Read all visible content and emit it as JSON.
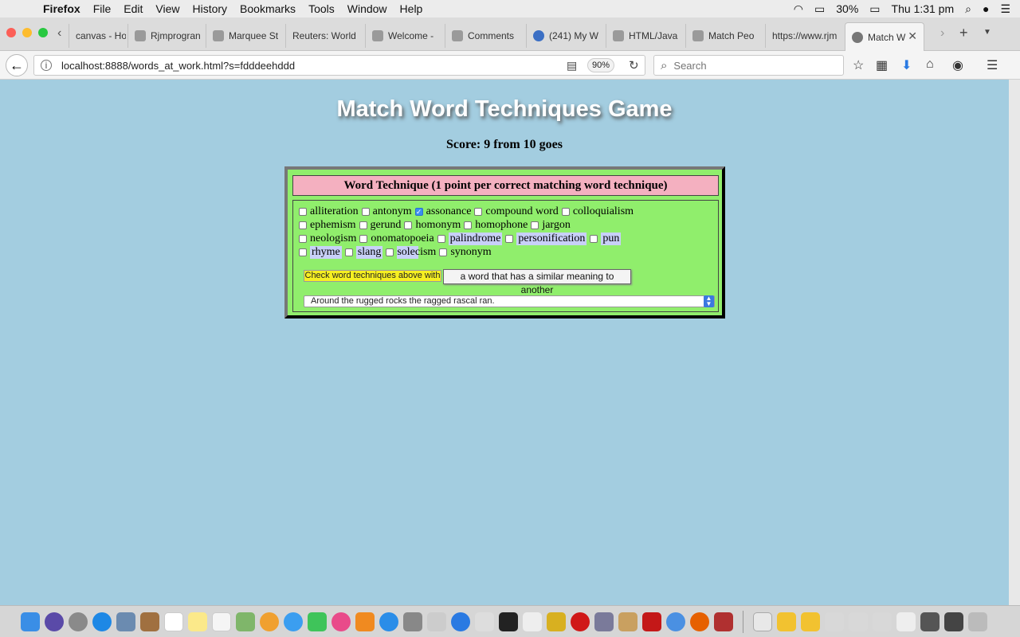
{
  "menubar": {
    "app_name": "Firefox",
    "items": [
      "File",
      "Edit",
      "View",
      "History",
      "Bookmarks",
      "Tools",
      "Window",
      "Help"
    ],
    "battery": "30%",
    "clock": "Thu 1:31 pm"
  },
  "tabs": [
    {
      "label": "canvas - Ho"
    },
    {
      "label": "Rjmprogran"
    },
    {
      "label": "Marquee St"
    },
    {
      "label": "Reuters: World"
    },
    {
      "label": "Welcome -"
    },
    {
      "label": "Comments"
    },
    {
      "label": "(241) My W"
    },
    {
      "label": "HTML/Java"
    },
    {
      "label": "Match Peo"
    },
    {
      "label": "https://www.rjm"
    },
    {
      "label": "Match W",
      "active": true
    }
  ],
  "navbar": {
    "url": "localhost:8888/words_at_work.html?s=fdddeehddd",
    "zoom": "90%",
    "search_placeholder": "Search"
  },
  "page": {
    "title": "Match Word Techniques Game",
    "score": "Score: 9 from 10 goes",
    "heading": "Word Technique (1 point per correct matching word technique)",
    "techniques": [
      {
        "label": "alliteration",
        "checked": false,
        "highlight": false
      },
      {
        "label": "antonym",
        "checked": false,
        "highlight": false
      },
      {
        "label": "assonance",
        "checked": true,
        "highlight": false
      },
      {
        "label": "compound word",
        "checked": false,
        "highlight": false
      },
      {
        "label": "colloquialism",
        "checked": false,
        "highlight": false
      },
      {
        "label": "ephemism",
        "checked": false,
        "highlight": false
      },
      {
        "label": "gerund",
        "checked": false,
        "highlight": false
      },
      {
        "label": "homonym",
        "checked": false,
        "highlight": false
      },
      {
        "label": "homophone",
        "checked": false,
        "highlight": false
      },
      {
        "label": "jargon",
        "checked": false,
        "highlight": false
      },
      {
        "label": "neologism",
        "checked": false,
        "highlight": false
      },
      {
        "label": "onomatopoeia",
        "checked": false,
        "highlight": false
      },
      {
        "label": "palindrome",
        "checked": false,
        "highlight": true
      },
      {
        "label": "personification",
        "checked": false,
        "highlight": true
      },
      {
        "label": "pun",
        "checked": false,
        "highlight": true
      },
      {
        "label": "rhyme",
        "checked": false,
        "highlight": true
      },
      {
        "label": "slang",
        "checked": false,
        "highlight": true
      },
      {
        "label": "solecism",
        "checked": false,
        "highlight": "partial"
      },
      {
        "label": "synonym",
        "checked": false,
        "highlight": false
      }
    ],
    "check_button": "Check word techniques above with",
    "definition_tooltip": "a word that has a similar meaning to another",
    "sentence_select": "Around the rugged rocks the ragged rascal ran."
  },
  "colors": {
    "page_bg": "#a3cde0",
    "game_bg": "#90ee6c",
    "heading_bg": "#f4b0c0",
    "button_bg": "#f6ef22",
    "highlight_bg": "#c8d0f8"
  }
}
